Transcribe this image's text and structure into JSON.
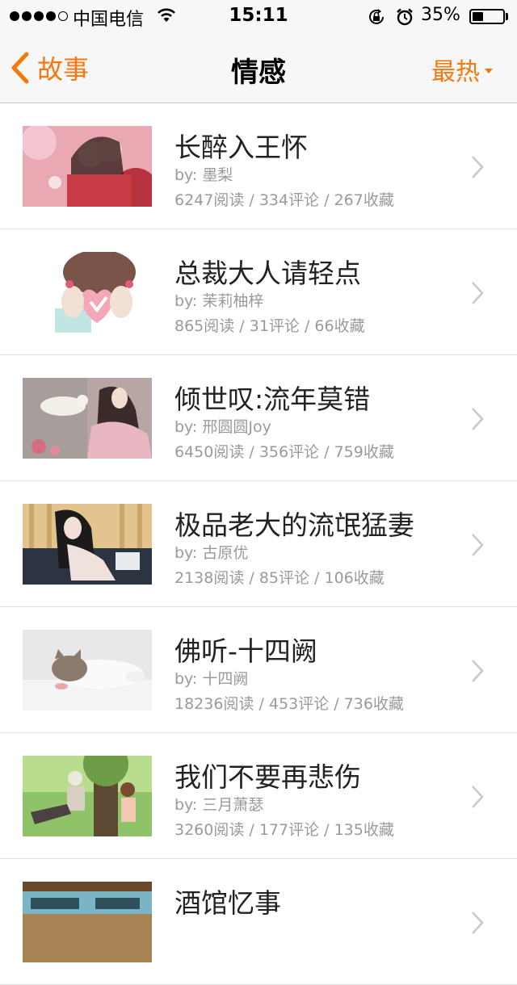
{
  "status_bar": {
    "carrier": "中国电信",
    "time": "15:11",
    "battery_percent": "35%",
    "battery_level": 0.35,
    "signal_bars_filled": 4,
    "signal_bars_total": 5
  },
  "nav": {
    "back_label": "故事",
    "title": "情感",
    "sort_label": "最热"
  },
  "colors": {
    "accent": "#f5780f",
    "title_text": "#222222",
    "meta_text": "#9a9a9a"
  },
  "stories": [
    {
      "title": "长醉入王怀",
      "author": "by: 墨梨",
      "stats": "6247阅读 / 334评论 / 267收藏"
    },
    {
      "title": "总裁大人请轻点",
      "author": "by: 茉莉柚梓",
      "stats": "865阅读 / 31评论 / 66收藏"
    },
    {
      "title": "倾世叹:流年莫错",
      "author": "by: 邢圆圆Joy",
      "stats": "6450阅读 / 356评论 / 759收藏"
    },
    {
      "title": "极品老大的流氓猛妻",
      "author": "by: 古原优",
      "stats": "2138阅读 / 85评论 / 106收藏"
    },
    {
      "title": "佛听-十四阙",
      "author": "by: 十四阙",
      "stats": "18236阅读 / 453评论 / 736收藏"
    },
    {
      "title": "我们不要再悲伤",
      "author": "by: 三月萧瑟",
      "stats": "3260阅读 / 177评论 / 135收藏"
    },
    {
      "title": "酒馆忆事",
      "author": "",
      "stats": ""
    }
  ]
}
